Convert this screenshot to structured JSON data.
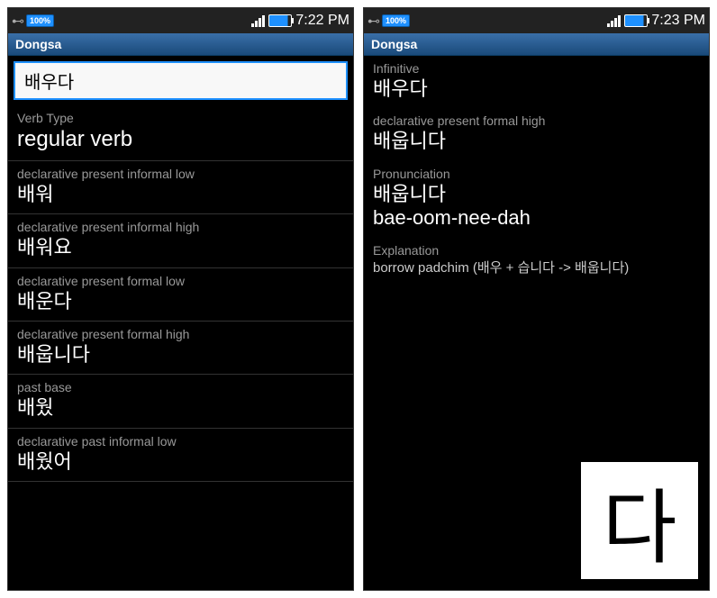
{
  "left": {
    "status": {
      "battery_text": "100%",
      "time": "7:22 PM"
    },
    "title": "Dongsa",
    "search_value": "배우다",
    "entries": [
      {
        "label": "Verb Type",
        "value": "regular verb",
        "large": true
      },
      {
        "label": "declarative present informal low",
        "value": "배워"
      },
      {
        "label": "declarative present informal high",
        "value": "배워요"
      },
      {
        "label": "declarative present formal low",
        "value": "배운다"
      },
      {
        "label": "declarative present formal high",
        "value": "배웁니다"
      },
      {
        "label": "past base",
        "value": "배웠"
      },
      {
        "label": "declarative past informal low",
        "value": "배웠어"
      }
    ]
  },
  "right": {
    "status": {
      "battery_text": "100%",
      "time": "7:23 PM"
    },
    "title": "Dongsa",
    "entries": [
      {
        "label": "Infinitive",
        "value": "배우다"
      },
      {
        "label": "declarative present formal high",
        "value": "배웁니다"
      },
      {
        "label": "Pronunciation",
        "value": "배웁니다",
        "value2": "bae-oom-nee-dah"
      },
      {
        "label": "Explanation",
        "text": "borrow padchim (배우 + 습니다 -> 배웁니다)"
      }
    ],
    "big_char": "다"
  }
}
